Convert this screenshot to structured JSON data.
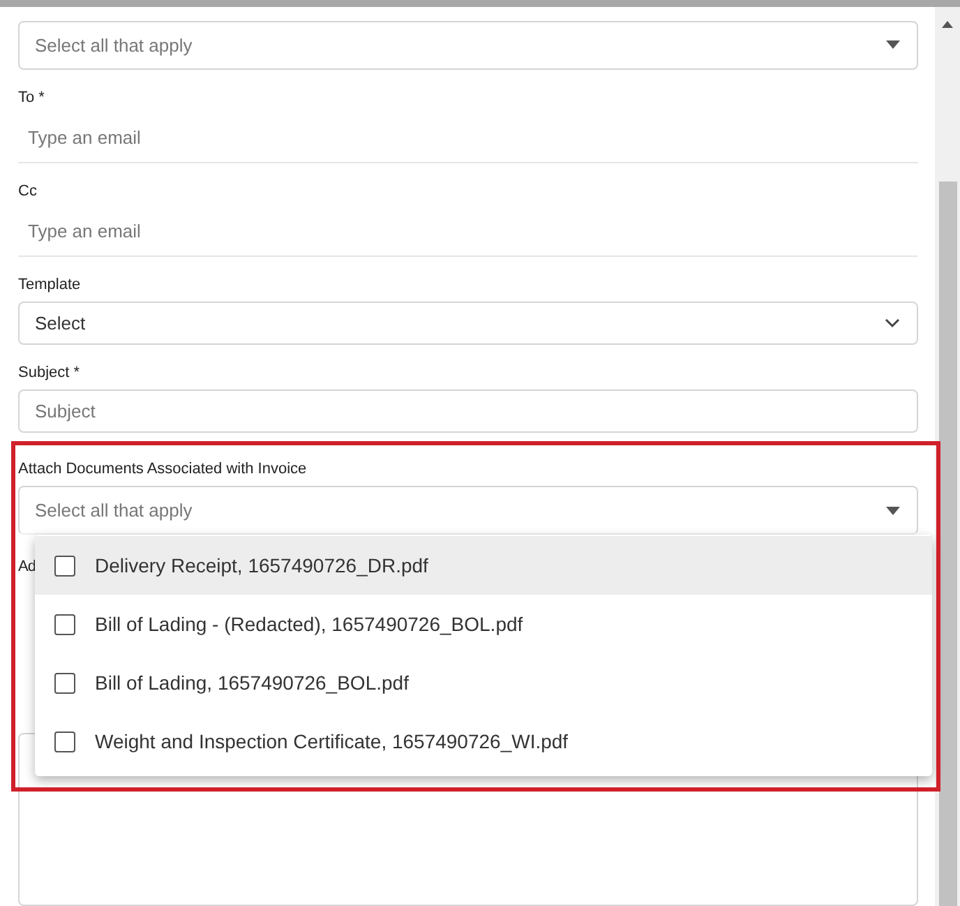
{
  "fields": [
    {
      "kind": "multiselect",
      "placeholder": "Select all that apply"
    },
    {
      "kind": "email",
      "label": "To *",
      "placeholder": "Type an email"
    },
    {
      "kind": "email",
      "label": "Cc",
      "placeholder": "Type an email"
    },
    {
      "kind": "select",
      "label": "Template",
      "value": "Select"
    },
    {
      "kind": "text",
      "label": "Subject *",
      "placeholder": "Subject"
    }
  ],
  "attach": {
    "label": "Attach Documents Associated with Invoice",
    "placeholder": "Select all that apply",
    "expanded": true,
    "highlighted": true,
    "options": [
      {
        "label": "Delivery Receipt, 1657490726_DR.pdf",
        "checked": false,
        "hovered": true
      },
      {
        "label": "Bill of Lading - (Redacted), 1657490726_BOL.pdf",
        "checked": false,
        "hovered": false
      },
      {
        "label": "Bill of Lading, 1657490726_BOL.pdf",
        "checked": false,
        "hovered": false
      },
      {
        "label": "Weight and Inspection Certificate, 1657490726_WI.pdf",
        "checked": false,
        "hovered": false
      }
    ]
  },
  "next_label": "Ad"
}
